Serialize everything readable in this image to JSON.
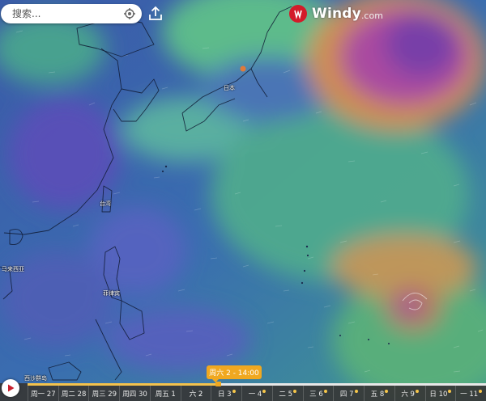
{
  "search": {
    "placeholder": "搜索..."
  },
  "brand": {
    "name": "Windy",
    "tld": ".com"
  },
  "map_labels": [
    "日本",
    "台湾",
    "菲律宾",
    "西沙群岛",
    "马来西亚"
  ],
  "timeline": {
    "current_time": "周六 2 - 14:00",
    "days": [
      {
        "label": "周一 27",
        "icon": ""
      },
      {
        "label": "周二 28",
        "icon": ""
      },
      {
        "label": "周三 29",
        "icon": ""
      },
      {
        "label": "周四 30",
        "icon": ""
      },
      {
        "label": "周五 1",
        "icon": ""
      },
      {
        "label": "六 2",
        "icon": ""
      },
      {
        "label": "日 3",
        "icon": "sun-icon"
      },
      {
        "label": "一 4",
        "icon": "sun-icon"
      },
      {
        "label": "二 5",
        "icon": "sun-icon"
      },
      {
        "label": "三 6",
        "icon": "sun-icon"
      },
      {
        "label": "四 7",
        "icon": "sun-icon"
      },
      {
        "label": "五 8",
        "icon": "sun-icon"
      },
      {
        "label": "六 9",
        "icon": "sun-icon"
      },
      {
        "label": "日 10",
        "icon": "sun-icon"
      },
      {
        "label": "一 11",
        "icon": "sun-icon"
      }
    ],
    "progress": 0.417
  },
  "colors": {
    "ocean_calm": "#3f5fb0",
    "moderate_wind": "#4fb48c",
    "strong_wind": "#d88a4a",
    "storm_core": "#b24aa8",
    "accent": "#f0a820",
    "brand_red": "#d31b2a"
  }
}
